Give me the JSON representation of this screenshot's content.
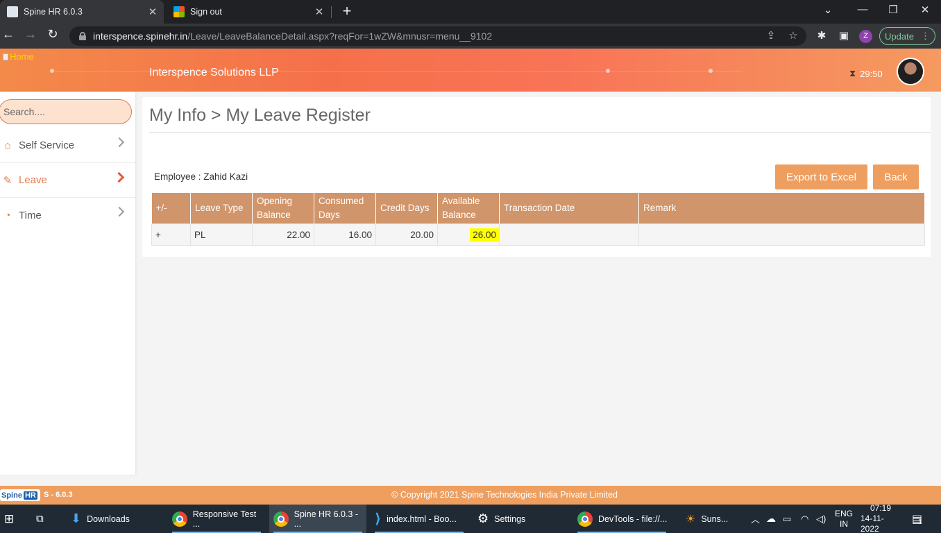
{
  "browser": {
    "tabs": [
      {
        "title": "Spine HR 6.0.3",
        "close": "✕"
      },
      {
        "title": "Sign out",
        "close": "✕"
      }
    ],
    "new_tab": "+",
    "url_host": "interspence.spinehr.in",
    "url_path": "/Leave/LeaveBalanceDetail.aspx?reqFor=1wZW&mnusr=menu__9102",
    "profile_initial": "Z",
    "update_label": "Update"
  },
  "header": {
    "home_label": "Home",
    "company": "Interspence Solutions LLP",
    "timer": "29:50"
  },
  "sidebar": {
    "search_placeholder": "Search....",
    "items": [
      {
        "label": "Self Service",
        "icon": "home-icon"
      },
      {
        "label": "Leave",
        "icon": "edit-icon"
      },
      {
        "label": "Time",
        "icon": "user-clock-icon"
      }
    ]
  },
  "main": {
    "title": "My Info > My Leave Register",
    "employee": "Employee : Zahid Kazi",
    "export_label": "Export to Excel",
    "back_label": "Back",
    "table": {
      "headers": [
        "+/-",
        "Leave Type",
        "Opening Balance",
        "Consumed Days",
        "Credit Days",
        "Available Balance",
        "Transaction Date",
        "Remark"
      ],
      "rows": [
        {
          "toggle": "+",
          "leave_type": "PL",
          "opening": "22.00",
          "consumed": "16.00",
          "credit": "20.00",
          "available": "26.00",
          "date": "",
          "remark": ""
        }
      ]
    }
  },
  "footer": {
    "logo_text": "Spine",
    "logo_hr": "HR",
    "version": "S - 6.0.3",
    "copyright": "© Copyright 2021 Spine Technologies India Private Limited"
  },
  "taskbar": {
    "items": [
      "Downloads",
      "Responsive Test ...",
      "Spine HR 6.0.3 - ...",
      "index.html - Boo...",
      "Settings",
      "DevTools - file://...",
      "Suns..."
    ],
    "lang": "ENG",
    "region": "IN",
    "time": "07:19",
    "date": "14-11-2022",
    "notifications": "1"
  },
  "colors": {
    "accent": "#ee9f60",
    "table_header": "#d0956a",
    "active_menu": "#e07b4d",
    "highlight": "#ffff00"
  }
}
